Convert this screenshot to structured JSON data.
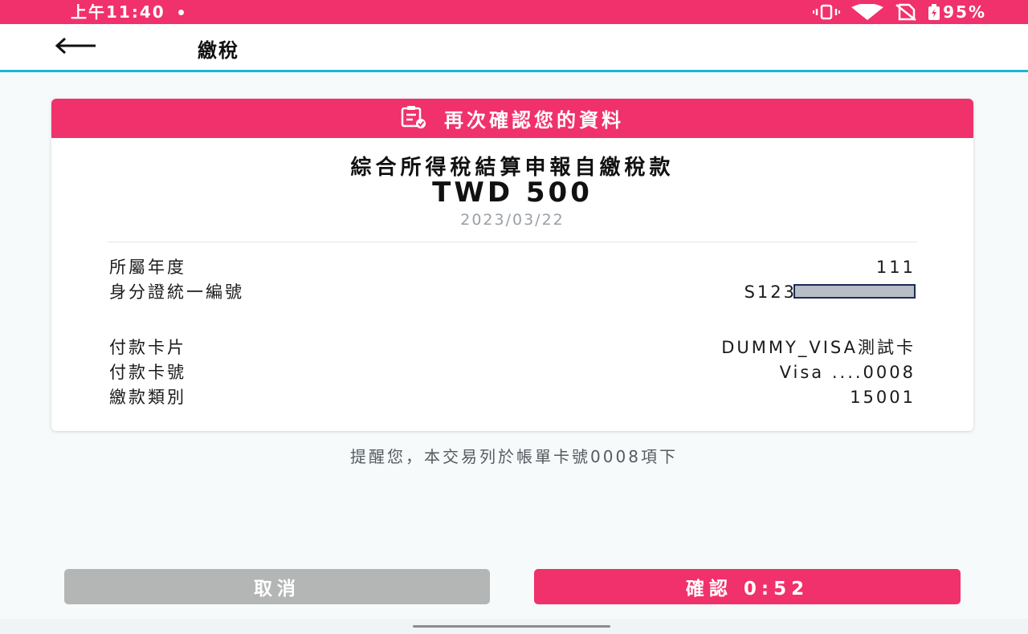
{
  "status_bar": {
    "time": "上午11:40",
    "battery": "95%",
    "background": "#f0316b"
  },
  "app_bar": {
    "title": "繳稅",
    "back_icon": "arrow-left-icon"
  },
  "card": {
    "header_title": "再次確認您的資料",
    "header_icon": "clipboard-check-icon",
    "tx_title": "綜合所得稅結算申報自繳稅款",
    "amount": "TWD 500",
    "date": "2023/03/22",
    "details": [
      {
        "label": "所屬年度",
        "value": "111"
      },
      {
        "label": "身分證統一編號",
        "value": "S123"
      },
      {
        "label": "付款卡片",
        "value": "DUMMY_VISA測試卡"
      },
      {
        "label": "付款卡號",
        "value": "Visa ....0008"
      },
      {
        "label": "繳款類別",
        "value": "15001"
      }
    ]
  },
  "reminder": "提醒您，本交易列於帳單卡號0008項下",
  "buttons": {
    "cancel_label": "取消",
    "confirm_label": "確認 0:52"
  },
  "colors": {
    "accent": "#f0316b",
    "divider_accent": "#19b6d9",
    "cancel_bg": "#b4b6b6"
  }
}
